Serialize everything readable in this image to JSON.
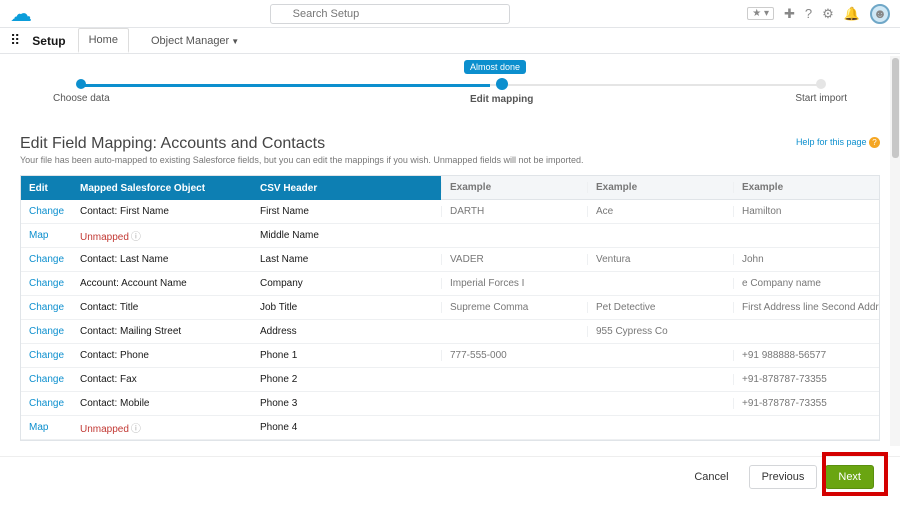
{
  "search_placeholder": "Search Setup",
  "nav": {
    "setup": "Setup",
    "home": "Home",
    "objmgr": "Object Manager"
  },
  "wizard": {
    "badge": "Almost done",
    "step1": "Choose data",
    "step2": "Edit mapping",
    "step3": "Start import"
  },
  "page": {
    "title": "Edit Field Mapping: Accounts and Contacts",
    "sub": "Your file has been auto-mapped to existing Salesforce fields, but you can edit the mappings if you wish. Unmapped fields will not be imported.",
    "help": "Help for this page"
  },
  "headers": {
    "edit": "Edit",
    "obj": "Mapped Salesforce Object",
    "csv": "CSV Header",
    "ex": "Example"
  },
  "rows": [
    {
      "action": "Change",
      "obj": "Contact: First Name",
      "csv": "First Name",
      "e1": "DARTH",
      "e2": "Ace",
      "e3": "Hamilton"
    },
    {
      "action": "Map",
      "obj": "Unmapped",
      "unmapped": true,
      "csv": "Middle Name",
      "e1": "",
      "e2": "",
      "e3": ""
    },
    {
      "action": "Change",
      "obj": "Contact: Last Name",
      "csv": "Last Name",
      "e1": "VADER",
      "e2": "Ventura",
      "e3": "John"
    },
    {
      "action": "Change",
      "obj": "Account: Account Name",
      "csv": "Company",
      "e1": "Imperial Forces I",
      "e2": "",
      "e3": "e Company name"
    },
    {
      "action": "Change",
      "obj": "Contact: Title",
      "csv": "Job Title",
      "e1": "Supreme Comma",
      "e2": "Pet Detective",
      "e3": "First Address line Second Address line"
    },
    {
      "action": "Change",
      "obj": "Contact: Mailing Street",
      "csv": "Address",
      "e1": "",
      "e2": "955 Cypress Co",
      "e3": ""
    },
    {
      "action": "Change",
      "obj": "Contact: Phone",
      "csv": "Phone 1",
      "e1": "777-555-000",
      "e2": "",
      "e3": "+91 988888-56577"
    },
    {
      "action": "Change",
      "obj": "Contact: Fax",
      "csv": "Phone 2",
      "e1": "",
      "e2": "",
      "e3": "+91-878787-73355"
    },
    {
      "action": "Change",
      "obj": "Contact: Mobile",
      "csv": "Phone 3",
      "e1": "",
      "e2": "",
      "e3": "+91-878787-73355"
    },
    {
      "action": "Map",
      "obj": "Unmapped",
      "unmapped": true,
      "csv": "Phone 4",
      "e1": "",
      "e2": "",
      "e3": ""
    }
  ],
  "footer": {
    "cancel": "Cancel",
    "prev": "Previous",
    "next": "Next"
  }
}
